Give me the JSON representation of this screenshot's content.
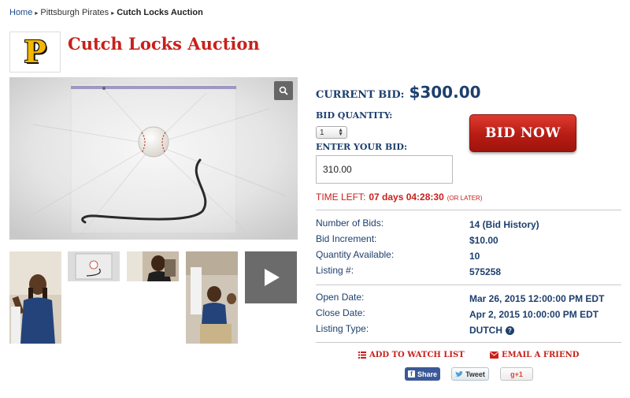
{
  "breadcrumb": {
    "home": "Home",
    "category": "Pittsburgh Pirates",
    "current": "Cutch Locks Auction"
  },
  "logo": {
    "letter": "P"
  },
  "auction": {
    "title": "Cutch Locks Auction"
  },
  "bid": {
    "current_label": "CURRENT BID:",
    "current_value": "$300.00",
    "quantity_label": "BID QUANTITY:",
    "quantity_value": "1",
    "enter_label": "ENTER YOUR BID:",
    "enter_value": "310.00",
    "bid_now_label": "BID NOW"
  },
  "time_left": {
    "label": "TIME LEFT:",
    "value": "07 days 04:28:30",
    "note": "(OR LATER)"
  },
  "details": [
    {
      "label": "Number of Bids:",
      "value": "14 (Bid History)"
    },
    {
      "label": "Bid Increment:",
      "value": "$10.00"
    },
    {
      "label": "Quantity Available:",
      "value": "10"
    },
    {
      "label": "Listing #:",
      "value": "575258"
    }
  ],
  "dates": [
    {
      "label": "Open Date:",
      "value": "Mar 26, 2015 12:00:00 PM EDT"
    },
    {
      "label": "Close Date:",
      "value": "Apr 2, 2015 10:00:00 PM EDT"
    },
    {
      "label": "Listing Type:",
      "value": "DUTCH"
    }
  ],
  "actions": {
    "watch_list": "ADD TO WATCH LIST",
    "email_friend": "EMAIL A FRIEND"
  },
  "social": {
    "facebook": "Share",
    "twitter": "Tweet",
    "google": "g+1"
  },
  "colors": {
    "brand_red": "#c8201b",
    "navy": "#1d3f6e",
    "pirates_gold": "#f5b800"
  },
  "icons": [
    "zoom-icon",
    "play-icon",
    "help-icon",
    "list-icon",
    "envelope-icon",
    "facebook-icon",
    "twitter-icon"
  ]
}
